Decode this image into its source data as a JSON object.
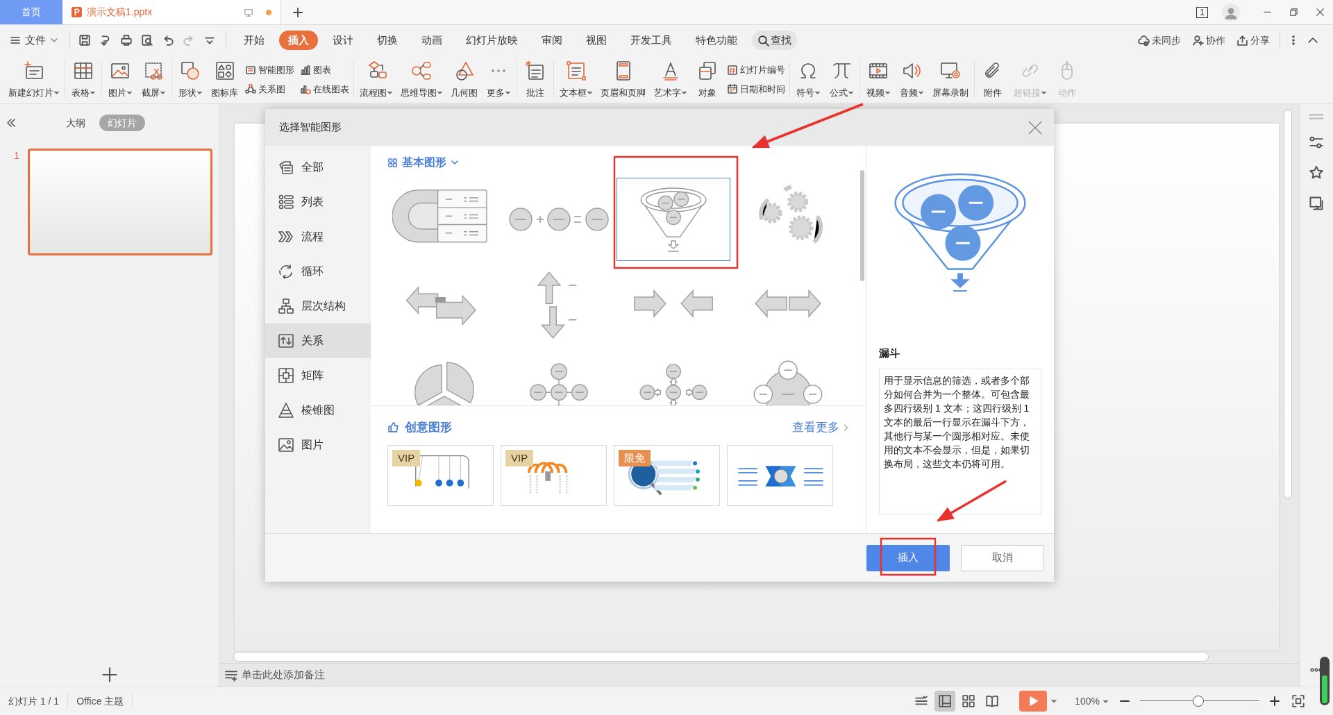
{
  "title_bar": {
    "tabs": [
      {
        "label": "首页",
        "kind": "home",
        "selected": false
      },
      {
        "label": "演示文稿1.pptx",
        "kind": "document",
        "selected": true,
        "unsaved": true
      }
    ],
    "window_count": "1"
  },
  "menu_bar": {
    "file": "文件",
    "tabs": [
      {
        "label": "开始",
        "selected": false
      },
      {
        "label": "插入",
        "selected": true
      },
      {
        "label": "设计",
        "selected": false
      },
      {
        "label": "切换",
        "selected": false
      },
      {
        "label": "动画",
        "selected": false
      },
      {
        "label": "幻灯片放映",
        "selected": false
      },
      {
        "label": "审阅",
        "selected": false
      },
      {
        "label": "视图",
        "selected": false
      },
      {
        "label": "开发工具",
        "selected": false
      },
      {
        "label": "特色功能",
        "selected": false
      }
    ],
    "search": "查找",
    "actions": [
      {
        "label": "未同步"
      },
      {
        "label": "协作"
      },
      {
        "label": "分享"
      }
    ]
  },
  "ribbon": {
    "groups": [
      [
        {
          "kind": "large",
          "label": "新建幻灯片",
          "dropdown": true,
          "disabled": false
        }
      ],
      [
        {
          "kind": "large",
          "label": "表格",
          "dropdown": true,
          "disabled": false
        }
      ],
      [
        {
          "kind": "large",
          "label": "图片",
          "dropdown": true,
          "disabled": false
        },
        {
          "kind": "large",
          "label": "截屏",
          "dropdown": true,
          "disabled": false
        }
      ],
      [
        {
          "kind": "large",
          "label": "形状",
          "dropdown": true,
          "disabled": false
        },
        {
          "kind": "large",
          "label": "图标库",
          "dropdown": false,
          "disabled": false
        },
        {
          "kind": "stack",
          "items": [
            {
              "label": "智能图形"
            },
            {
              "label": "关系图"
            }
          ]
        },
        {
          "kind": "stack",
          "items": [
            {
              "label": "图表"
            },
            {
              "label": "在线图表"
            }
          ]
        }
      ],
      [
        {
          "kind": "large",
          "label": "流程图",
          "dropdown": true,
          "disabled": false
        },
        {
          "kind": "large",
          "label": "思维导图",
          "dropdown": true,
          "disabled": false
        },
        {
          "kind": "large",
          "label": "几何图",
          "dropdown": false,
          "disabled": false
        },
        {
          "kind": "large",
          "label": "更多",
          "dropdown": true,
          "disabled": false
        }
      ],
      [
        {
          "kind": "large",
          "label": "批注",
          "dropdown": false,
          "disabled": false
        }
      ],
      [
        {
          "kind": "large",
          "label": "文本框",
          "dropdown": true,
          "disabled": false
        },
        {
          "kind": "large",
          "label": "页眉和页脚",
          "dropdown": false,
          "disabled": false
        },
        {
          "kind": "large",
          "label": "艺术字",
          "dropdown": true,
          "disabled": false
        },
        {
          "kind": "large",
          "label": "对象",
          "dropdown": false,
          "disabled": false
        },
        {
          "kind": "stack",
          "items": [
            {
              "label": "幻灯片编号"
            },
            {
              "label": "日期和时间"
            }
          ]
        }
      ],
      [
        {
          "kind": "large",
          "label": "符号",
          "dropdown": true,
          "disabled": false
        },
        {
          "kind": "large",
          "label": "公式",
          "dropdown": true,
          "disabled": false
        }
      ],
      [
        {
          "kind": "large",
          "label": "视频",
          "dropdown": true,
          "disabled": false
        },
        {
          "kind": "large",
          "label": "音频",
          "dropdown": true,
          "disabled": false
        },
        {
          "kind": "large",
          "label": "屏幕录制",
          "dropdown": false,
          "disabled": false
        }
      ],
      [
        {
          "kind": "large",
          "label": "附件",
          "dropdown": false,
          "disabled": false
        },
        {
          "kind": "large",
          "label": "超链接",
          "dropdown": true,
          "disabled": true
        },
        {
          "kind": "large",
          "label": "动作",
          "dropdown": false,
          "disabled": true
        }
      ]
    ]
  },
  "slide_panel": {
    "view_tabs": [
      {
        "label": "大纲",
        "selected": false
      },
      {
        "label": "幻灯片",
        "selected": true
      }
    ],
    "slides": [
      {
        "number": "1",
        "selected": true
      }
    ]
  },
  "notes": {
    "placeholder": "单击此处添加备注"
  },
  "dialog": {
    "title": "选择智能图形",
    "categories": [
      {
        "label": "全部",
        "selected": false
      },
      {
        "label": "列表",
        "selected": false
      },
      {
        "label": "流程",
        "selected": false
      },
      {
        "label": "循环",
        "selected": false
      },
      {
        "label": "层次结构",
        "selected": false
      },
      {
        "label": "关系",
        "selected": true
      },
      {
        "label": "矩阵",
        "selected": false
      },
      {
        "label": "棱锥图",
        "selected": false
      },
      {
        "label": "图片",
        "selected": false
      }
    ],
    "section_title": "基本图形",
    "shapes": [
      {
        "selected": false
      },
      {
        "selected": false
      },
      {
        "selected": true
      },
      {
        "selected": false
      },
      {
        "selected": false
      },
      {
        "selected": false
      },
      {
        "selected": false
      },
      {
        "selected": false
      },
      {
        "selected": false
      },
      {
        "selected": false
      },
      {
        "selected": false
      },
      {
        "selected": false
      }
    ],
    "creative": {
      "title": "创意图形",
      "more": "查看更多",
      "templates": [
        {
          "kind": "vip",
          "badge": "VIP"
        },
        {
          "kind": "vip",
          "badge": "VIP"
        },
        {
          "kind": "free",
          "badge": "限免"
        },
        {
          "kind": "plain"
        }
      ]
    },
    "preview": {
      "name": "漏斗",
      "description": "用于显示信息的筛选，或者多个部分如何合并为一个整体。可包含最多四行级别 1 文本；这四行级别 1 文本的最后一行显示在漏斗下方，其他行与某一个圆形相对应。未使用的文本不会显示，但是，如果切换布局，这些文本仍将可用。"
    },
    "buttons": [
      {
        "label": "插入",
        "kind": "primary"
      },
      {
        "label": "取消",
        "kind": "secondary"
      }
    ]
  },
  "status_bar": {
    "slide_info": "幻灯片 1 / 1",
    "theme": "Office 主题",
    "views": [
      {
        "selected": false
      },
      {
        "selected": true
      },
      {
        "selected": false
      },
      {
        "selected": false
      }
    ],
    "zoom": "100%",
    "zoom_slider": {
      "level": 0.49
    }
  }
}
